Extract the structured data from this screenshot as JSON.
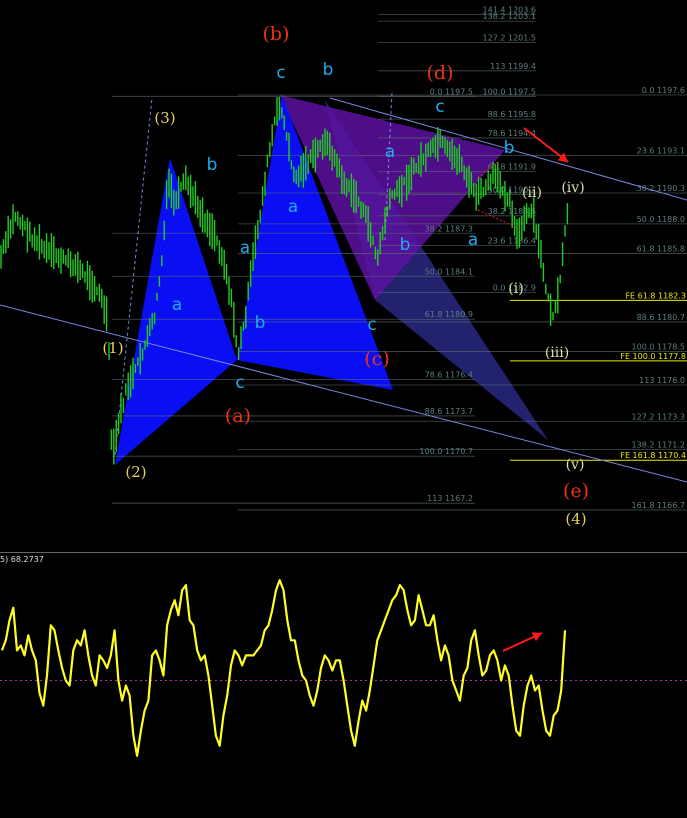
{
  "colors": {
    "background": "#000000",
    "grid_line": "#5e6e6e",
    "fib_text": "#5e7e7e",
    "fe_line": "#e8e800",
    "candle": "#22cc22",
    "channel": "#7a86e0",
    "pattern_blue": "#0a10ff",
    "pattern_purple": "#5a10a0",
    "pattern_navy": "#2a2a88",
    "oscillator": "#ffff22",
    "arrow": "#ff1a1a",
    "label_cyan": "#22aaee",
    "label_yellow": "#e6d25a",
    "label_red": "#ee3311",
    "label_pale": "#d8e0a8",
    "indicator_text": "#dddddd"
  },
  "chart_data": [
    {
      "type": "candlestick",
      "name": "main-price-chart",
      "ylim": [
        1165.8,
        1204.3
      ],
      "fib_retracements": [
        {
          "level": "141.4",
          "price": "1203.6"
        },
        {
          "level": "138.2",
          "price": "1203.1"
        },
        {
          "level": "127.2",
          "price": "1201.5"
        },
        {
          "level": "113",
          "price": "1199.4"
        },
        {
          "level": "100.0",
          "price": "1197.5"
        },
        {
          "level": "88.6",
          "price": "1195.8"
        },
        {
          "level": "78.6",
          "price": "1194.4"
        },
        {
          "level": "61.8",
          "price": "1191.9"
        },
        {
          "level": "50.0",
          "price": "1190.2"
        },
        {
          "level": "38.2",
          "price": "1188.6"
        },
        {
          "level": "23.6",
          "price": "1186.4"
        },
        {
          "level": "0.0",
          "price": "1182.9"
        },
        {
          "level": "0.0",
          "price": "1197.5"
        },
        {
          "level": "38.2",
          "price": "1187.3"
        },
        {
          "level": "50.0",
          "price": "1184.1"
        },
        {
          "level": "61.8",
          "price": "1180.9"
        },
        {
          "level": "78.6",
          "price": "1176.4"
        },
        {
          "level": "88.6",
          "price": "1173.7"
        },
        {
          "level": "100.0",
          "price": "1170.7"
        },
        {
          "level": "113",
          "price": "1167.2"
        },
        {
          "level": "0.0",
          "price": "1197.6"
        },
        {
          "level": "23.6",
          "price": "1193.1"
        },
        {
          "level": "38.2",
          "price": "1190.3"
        },
        {
          "level": "50.0",
          "price": "1188.0"
        },
        {
          "level": "61.8",
          "price": "1185.8"
        },
        {
          "level": "88.6",
          "price": "1180.7"
        },
        {
          "level": "100.0",
          "price": "1178.5"
        },
        {
          "level": "113",
          "price": "1176.0"
        },
        {
          "level": "127.2",
          "price": "1173.3"
        },
        {
          "level": "138.2",
          "price": "1171.2"
        },
        {
          "level": "161.8",
          "price": "1166.7"
        }
      ],
      "fe_levels": [
        {
          "label": "FE 61.8",
          "price": "1182.3"
        },
        {
          "label": "FE 100.0",
          "price": "1177.8"
        },
        {
          "label": "FE 161.8",
          "price": "1170.4"
        }
      ],
      "wave_labels": [
        {
          "text": "(b)",
          "color": "label_red"
        },
        {
          "text": "(d)",
          "color": "label_red"
        },
        {
          "text": "(c)",
          "color": "label_red"
        },
        {
          "text": "(a)",
          "color": "label_red"
        },
        {
          "text": "(e)",
          "color": "label_red"
        },
        {
          "text": "(3)",
          "color": "label_yellow"
        },
        {
          "text": "(1)",
          "color": "label_yellow"
        },
        {
          "text": "(2)",
          "color": "label_yellow"
        },
        {
          "text": "(4)",
          "color": "label_yellow"
        },
        {
          "text": "(i)",
          "color": "label_pale"
        },
        {
          "text": "(ii)",
          "color": "label_pale"
        },
        {
          "text": "(iii)",
          "color": "label_pale"
        },
        {
          "text": "(iv)",
          "color": "label_pale"
        },
        {
          "text": "(v)",
          "color": "label_pale"
        },
        {
          "text": "a",
          "color": "label_cyan"
        },
        {
          "text": "b",
          "color": "label_cyan"
        },
        {
          "text": "c",
          "color": "label_cyan"
        }
      ]
    },
    {
      "type": "line",
      "name": "oscillator-panel",
      "label": "5) 68.2737",
      "ylim": [
        0,
        100
      ],
      "reference_level": 50,
      "values": [
        62,
        66,
        74,
        79,
        62,
        64,
        60,
        68,
        62,
        58,
        45,
        40,
        52,
        72,
        70,
        62,
        55,
        50,
        48,
        62,
        66,
        64,
        70,
        60,
        52,
        48,
        60,
        58,
        55,
        60,
        70,
        50,
        42,
        48,
        44,
        28,
        20,
        30,
        38,
        42,
        60,
        62,
        58,
        52,
        72,
        78,
        82,
        76,
        86,
        88,
        74,
        72,
        62,
        58,
        60,
        52,
        40,
        28,
        24,
        36,
        44,
        56,
        62,
        60,
        56,
        60,
        60,
        60,
        62,
        64,
        70,
        72,
        78,
        86,
        90,
        86,
        74,
        66,
        66,
        58,
        52,
        50,
        44,
        40,
        46,
        55,
        60,
        58,
        54,
        58,
        58,
        50,
        40,
        30,
        24,
        34,
        42,
        38,
        46,
        56,
        66,
        70,
        74,
        78,
        82,
        84,
        88,
        86,
        78,
        72,
        74,
        84,
        78,
        72,
        72,
        76,
        66,
        58,
        64,
        60,
        50,
        46,
        42,
        52,
        55,
        66,
        70,
        60,
        52,
        54,
        60,
        62,
        58,
        50,
        56,
        52,
        40,
        30,
        28,
        40,
        48,
        52,
        46,
        48,
        38,
        30,
        28,
        36,
        38,
        46,
        70
      ]
    }
  ]
}
